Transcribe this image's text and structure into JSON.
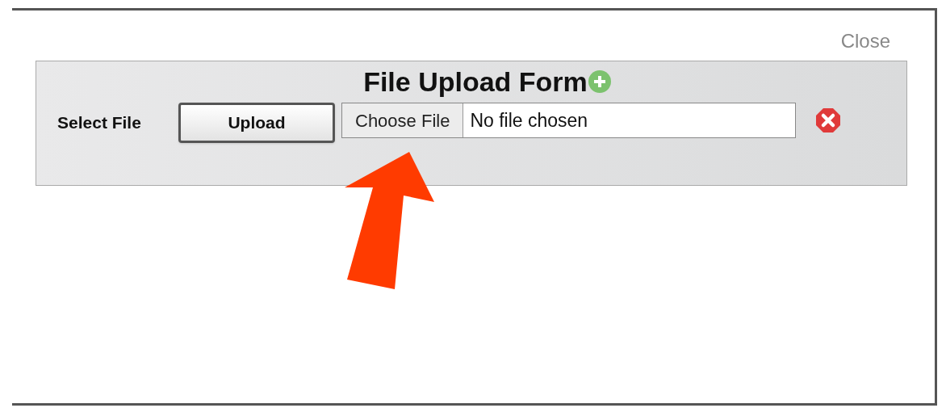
{
  "close_link": "Close",
  "form": {
    "title": "File Upload Form",
    "field_label": "Select File",
    "upload_button": "Upload",
    "file_input": {
      "button": "Choose File",
      "status": "No file chosen"
    }
  },
  "annotation": {
    "kind": "arrow"
  }
}
